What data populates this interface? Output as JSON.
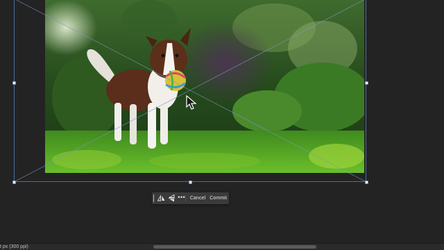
{
  "taskbar": {
    "flip_horizontal_icon": "flip-horizontal-icon",
    "flip_vertical_icon": "flip-vertical-icon",
    "more_label": "•••",
    "cancel_label": "Cancel",
    "commit_label": "Commit"
  },
  "status_bar": {
    "info_text": "t px (300 ppi)"
  },
  "canvas": {
    "photo_description_icon": "dog-photo",
    "cursor_icon": "arrow-cursor-icon"
  },
  "colors": {
    "background": "#232323",
    "bounding_box": "#4a6fa5",
    "taskbar_bg": "#3a3a3a"
  }
}
